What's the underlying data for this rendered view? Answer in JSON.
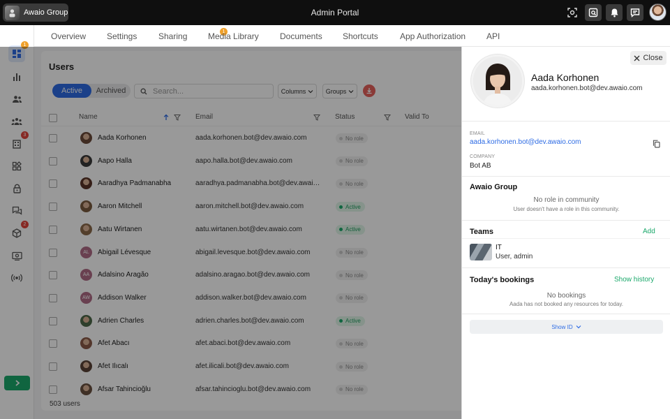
{
  "topbar": {
    "org_name": "Awaio Group",
    "portal_title": "Admin Portal"
  },
  "tabs": [
    {
      "label": "Overview"
    },
    {
      "label": "Settings"
    },
    {
      "label": "Sharing",
      "badge": "1"
    },
    {
      "label": "Media Library"
    },
    {
      "label": "Documents"
    },
    {
      "label": "Shortcuts"
    },
    {
      "label": "App Authorization"
    },
    {
      "label": "API"
    }
  ],
  "leftnav": {
    "badges": {
      "dashboard": "1",
      "buildings": "3",
      "packages": "2"
    }
  },
  "users": {
    "title": "Users",
    "segment_active": "Active",
    "segment_archived": "Archived",
    "search_placeholder": "Search...",
    "columns_button": "Columns",
    "groups_button": "Groups",
    "headers": {
      "name": "Name",
      "email": "Email",
      "status": "Status",
      "valid_to": "Valid To"
    },
    "rows": [
      {
        "name": "Aada Korhonen",
        "email": "aada.korhonen.bot@dev.awaio.com",
        "status": "No role",
        "avatar": "photo",
        "color": "#6b4a3a"
      },
      {
        "name": "Aapo Halla",
        "email": "aapo.halla.bot@dev.awaio.com",
        "status": "No role",
        "avatar": "photo",
        "color": "#3b3b3b"
      },
      {
        "name": "Aaradhya Padmanabha",
        "email": "aaradhya.padmanabha.bot@dev.awaio.com",
        "status": "No role",
        "avatar": "photo",
        "color": "#5a3428"
      },
      {
        "name": "Aaron Mitchell",
        "email": "aaron.mitchell.bot@dev.awaio.com",
        "status": "Active",
        "avatar": "photo",
        "color": "#7a5a3e"
      },
      {
        "name": "Aatu Wirtanen",
        "email": "aatu.wirtanen.bot@dev.awaio.com",
        "status": "Active",
        "avatar": "photo",
        "color": "#8a6a4a"
      },
      {
        "name": "Abigail Lévesque",
        "email": "abigail.levesque.bot@dev.awaio.com",
        "status": "No role",
        "avatar": "AL",
        "color": "#b06b86"
      },
      {
        "name": "Adalsino Aragão",
        "email": "adalsino.aragao.bot@dev.awaio.com",
        "status": "No role",
        "avatar": "AA",
        "color": "#b06b86"
      },
      {
        "name": "Addison Walker",
        "email": "addison.walker.bot@dev.awaio.com",
        "status": "No role",
        "avatar": "AW",
        "color": "#b06b86"
      },
      {
        "name": "Adrien Charles",
        "email": "adrien.charles.bot@dev.awaio.com",
        "status": "Active",
        "avatar": "photo",
        "color": "#4e6a4a"
      },
      {
        "name": "Afet Abacı",
        "email": "afet.abaci.bot@dev.awaio.com",
        "status": "No role",
        "avatar": "photo",
        "color": "#8a5a48"
      },
      {
        "name": "Afet Ilıcalı",
        "email": "afet.ilicali.bot@dev.awaio.com",
        "status": "No role",
        "avatar": "photo",
        "color": "#5a4236"
      },
      {
        "name": "Afsar Tahincioğlu",
        "email": "afsar.tahincioglu.bot@dev.awaio.com",
        "status": "No role",
        "avatar": "photo",
        "color": "#6a5040"
      }
    ],
    "count_label": "503 users"
  },
  "profile": {
    "close_label": "Close",
    "name": "Aada Korhonen",
    "email": "aada.korhonen.bot@dev.awaio.com",
    "email_label": "EMAIL",
    "email_value": "aada.korhonen.bot@dev.awaio.com",
    "company_label": "COMPANY",
    "company_value": "Bot AB",
    "community_title": "Awaio Group",
    "community_main": "No role in community",
    "community_sub": "User doesn't have a role in this community.",
    "teams_title": "Teams",
    "teams_add": "Add",
    "team_name": "IT",
    "team_role": "User, admin",
    "bookings_title": "Today's bookings",
    "bookings_history": "Show history",
    "bookings_main": "No bookings",
    "bookings_sub": "Aada has not booked any resources for today.",
    "show_id": "Show ID"
  },
  "colors": {
    "accent_blue": "#2d6be4",
    "accent_green": "#1ba86b",
    "badge_orange": "#f0a12b",
    "badge_red": "#e2453c"
  }
}
